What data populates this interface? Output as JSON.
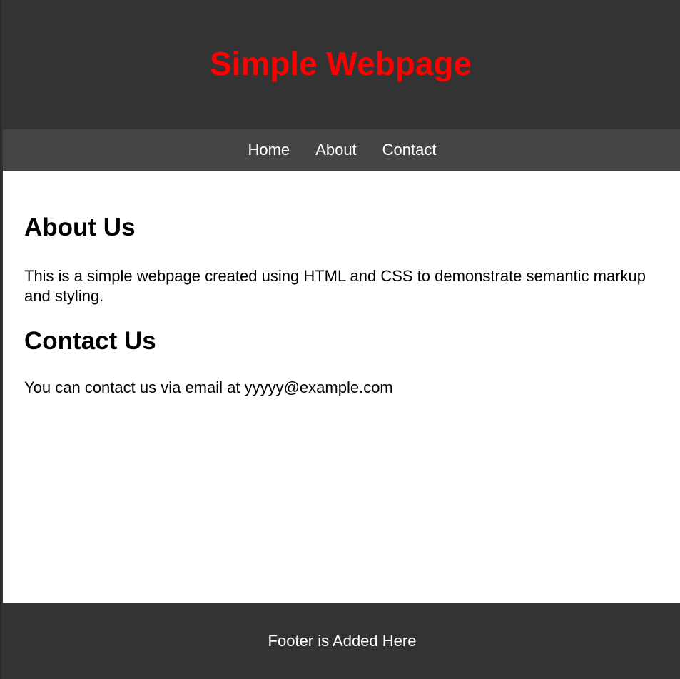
{
  "header": {
    "title": "Simple Webpage"
  },
  "nav": {
    "items": [
      {
        "label": "Home"
      },
      {
        "label": "About"
      },
      {
        "label": "Contact"
      }
    ]
  },
  "main": {
    "about": {
      "heading": "About Us",
      "text": "This is a simple webpage created using HTML and CSS to demonstrate semantic markup and styling."
    },
    "contact": {
      "heading": "Contact Us",
      "text": "You can contact us via email at yyyyy@example.com"
    }
  },
  "footer": {
    "text": "Footer is Added Here"
  },
  "colors": {
    "header_background": "#333333",
    "title": "#ff0000",
    "nav_background": "#444444",
    "nav_text": "#ffffff",
    "content_background": "#ffffff",
    "body_text": "#000000",
    "footer_background": "#333333",
    "footer_text": "#ffffff"
  }
}
